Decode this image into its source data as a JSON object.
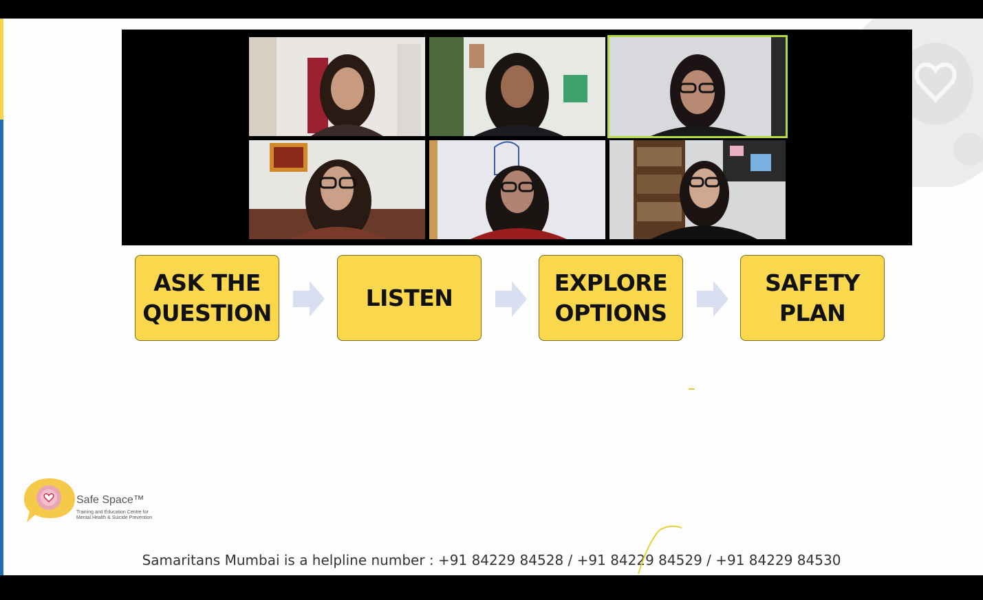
{
  "steps": [
    {
      "label": "ASK THE\nQUESTION"
    },
    {
      "label": "LISTEN"
    },
    {
      "label": "EXPLORE\nOPTIONS"
    },
    {
      "label": "SAFETY\nPLAN"
    }
  ],
  "logo": {
    "name": "Safe Space™",
    "tagline": "Training and Education Centre for\nMental Health & Suicide Prevention"
  },
  "footer": {
    "helpline": "Samaritans Mumbai is a helpline number : +91 84229 84528 / +91 84229 84529 / +91 84229 84530"
  },
  "colors": {
    "step_fill": "#fad84e",
    "active_speaker_border": "#b5dc3d",
    "accent_blue": "#1f6fb2",
    "accent_yellow": "#f6d44a"
  }
}
